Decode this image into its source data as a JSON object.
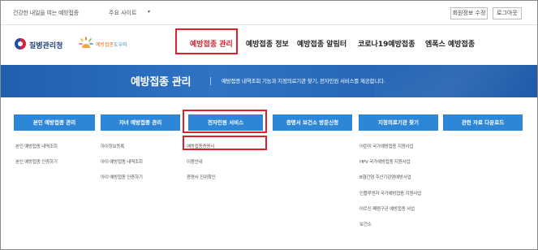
{
  "utility": {
    "slogan": "건강한 내일을 여는 예방접종",
    "sites_label": "주요 사이트",
    "caret": "▾",
    "edit_button": "회원정보 수정",
    "logout_button": "로그아웃"
  },
  "header": {
    "logo_kdca": "질병관리청",
    "logo_helper_a": "예방접종",
    "logo_helper_b": "도우미",
    "nav": [
      "예방접종 관리",
      "예방접종 정보",
      "예방접종 알림터",
      "코로나19예방접종",
      "엠폭스 예방접종"
    ],
    "active_index": 0
  },
  "banner": {
    "title": "예방접종 관리",
    "description": "예방접종 내역조회 기능과 지정의료기관 찾기, 전자민원 서비스를 제공합니다."
  },
  "columns": [
    {
      "title": "본인 예방접종 관리",
      "items": [
        "본인 예방접종 내역조회",
        "본인 예방접종 인증하기"
      ]
    },
    {
      "title": "자녀 예방접종 관리",
      "items": [
        "아이정보등록",
        "아이 예방접종 내역조회",
        "아이 예방접종 인증하기"
      ]
    },
    {
      "title": "전자민원 서비스",
      "items": [
        "예방접종증명서",
        "이용안내",
        "증명서 진위확인"
      ]
    },
    {
      "title": "증명서 보건소 방문신청",
      "items": []
    },
    {
      "title": "지정의료기관 찾기",
      "items": [
        "어린이 국가예방접종 지원사업",
        "HPV 국가예방접종 지원사업",
        "B형간염 주산기감염예방사업",
        "인플루엔자 국가예방접종 지원사업",
        "어르신 폐렴구균 예방접종 사업",
        "보건소"
      ]
    },
    {
      "title": "관련 자료 다운로드",
      "items": []
    }
  ],
  "colors": {
    "accent_red": "#e11e2b",
    "button_blue": "#2e86d6",
    "banner_blue": "#2f74c4"
  }
}
